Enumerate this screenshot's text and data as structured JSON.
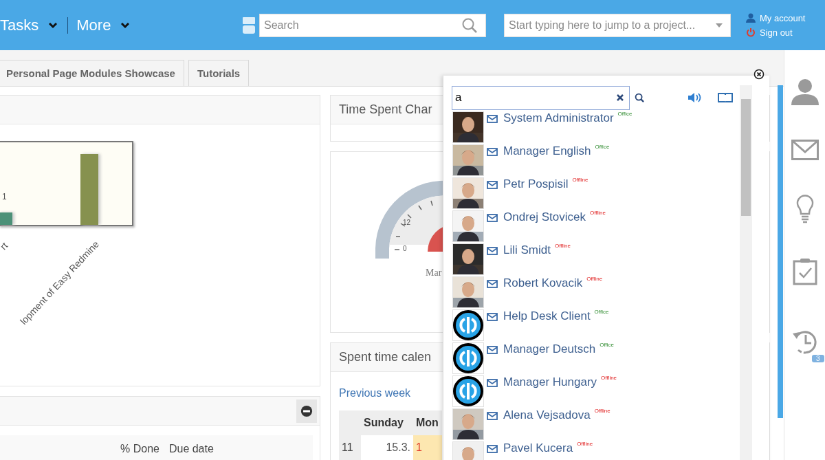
{
  "header": {
    "menus": [
      {
        "label": "Tasks"
      },
      {
        "label": "More"
      }
    ],
    "search": {
      "placeholder": "Search"
    },
    "project_jump": {
      "placeholder": "Start typing here to jump to a project..."
    },
    "account": {
      "my_account": "My account",
      "sign_out": "Sign out"
    }
  },
  "tabs": [
    {
      "label": "Personal Page Modules Showcase",
      "selected": false
    },
    {
      "label": "Tutorials",
      "selected": false
    }
  ],
  "left_panel": {
    "chart": {
      "value_label": "1",
      "category_labels": [
        "rt",
        "lopment of Easy Redmine"
      ]
    }
  },
  "task_panel": {
    "columns": [
      "% Done",
      "Due date"
    ]
  },
  "time_chart_panel": {
    "title": "Time Spent Char"
  },
  "gauge": {
    "tick_labels": [
      "12",
      "0"
    ],
    "caption": "Mar"
  },
  "calendar": {
    "title": "Spent time calen",
    "previous_link": "Previous week",
    "days": [
      "Sunday",
      "Mon"
    ],
    "rows": [
      {
        "week": "11",
        "cells": [
          "15.3.",
          "1"
        ]
      }
    ]
  },
  "people_popup": {
    "query": "a",
    "users": [
      {
        "name": "System Administrator",
        "status": "Office",
        "online": true
      },
      {
        "name": "Manager English",
        "status": "Office",
        "online": true
      },
      {
        "name": "Petr Pospisil",
        "status": "Offline",
        "online": false
      },
      {
        "name": "Ondrej Stovicek",
        "status": "Offline",
        "online": false
      },
      {
        "name": "Lili Smidt",
        "status": "Offline",
        "online": false
      },
      {
        "name": "Robert Kovacik",
        "status": "Offline",
        "online": false
      },
      {
        "name": "Help Desk Client",
        "status": "Office",
        "online": true,
        "kind": "logo"
      },
      {
        "name": "Manager Deutsch",
        "status": "Office",
        "online": true,
        "kind": "logo"
      },
      {
        "name": "Manager Hungary",
        "status": "Offline",
        "online": false,
        "kind": "logo"
      },
      {
        "name": "Alena Vejsadova",
        "status": "Offline",
        "online": false
      },
      {
        "name": "Pavel Kucera",
        "status": "Offline",
        "online": false
      }
    ]
  },
  "sidebar": {
    "history_badge": "3"
  }
}
